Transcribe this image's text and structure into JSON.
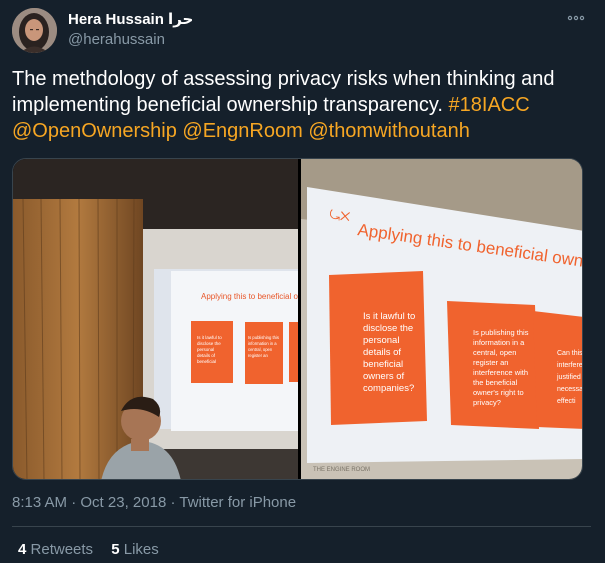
{
  "user": {
    "display_name": "Hera Hussain حرا",
    "handle": "@herahussain"
  },
  "icons": {
    "more": "more-horizontal-icon",
    "avatar": "profile-photo"
  },
  "tweet": {
    "text_plain": "The methdology of assessing privacy risks when thinking and implementing beneficial ownership transparency. ",
    "links": [
      "#18IACC",
      "@OpenOwnership",
      "@EngnRoom",
      "@thomwithoutanh"
    ],
    "link_separator": " "
  },
  "media": {
    "slide_title": "Applying this to beneficial ownership:",
    "box1": "Is it lawful to disclose the personal details of beneficial owners of companies?",
    "box2": "Is publishing this information in a central, open register an interference with the beneficial owner's right to privacy?",
    "box3": "Can this interference be justified and necessary effective"
  },
  "meta": {
    "time": "8:13 AM",
    "date": "Oct 23, 2018",
    "source": "Twitter for iPhone",
    "separator": " · "
  },
  "stats": {
    "retweets_count": "4",
    "retweets_label": "Retweets",
    "likes_count": "5",
    "likes_label": "Likes"
  },
  "colors": {
    "background": "#15202b",
    "link": "#f6a623",
    "secondary_text": "#8899a6",
    "slide_orange": "#f0632e"
  }
}
